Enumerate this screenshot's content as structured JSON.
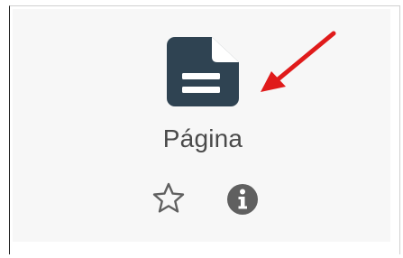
{
  "activity": {
    "label": "Página",
    "icon": "file-text-icon",
    "icon_color": "#2f4352"
  },
  "actions": {
    "favourite_icon": "star-outline-icon",
    "info_icon": "info-circle-icon",
    "icon_color": "#606060"
  },
  "annotation": {
    "arrow_color": "#e01b1b"
  }
}
